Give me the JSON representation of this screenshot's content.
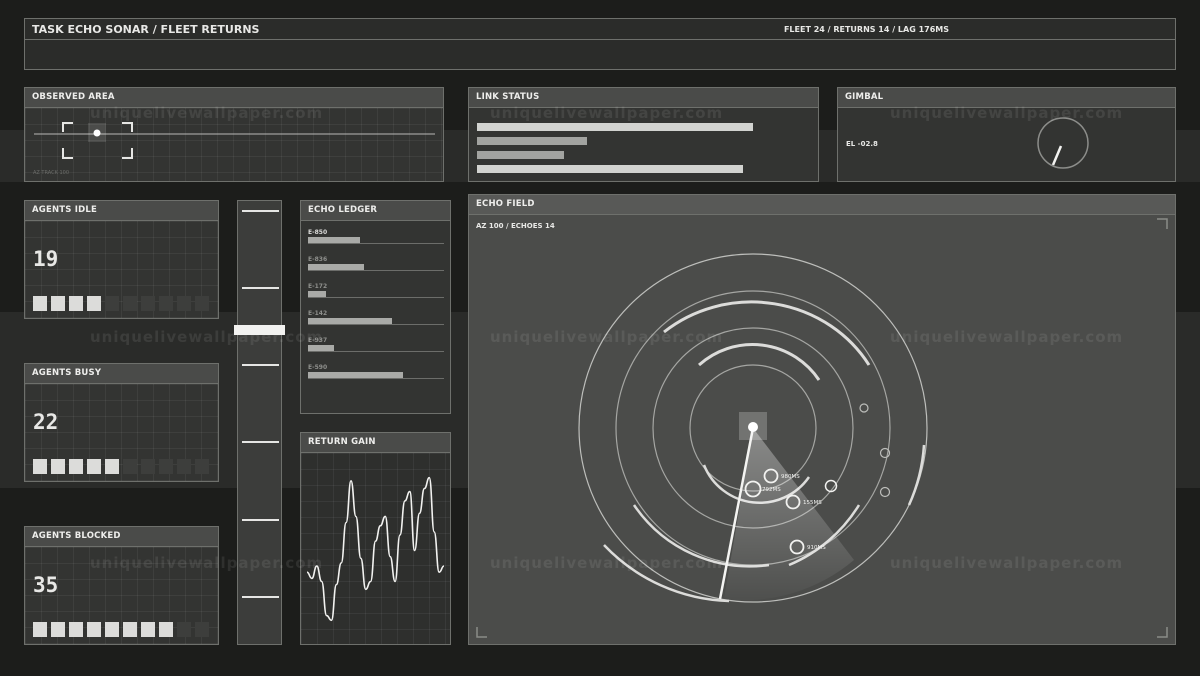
{
  "header": {
    "title": "TASK ECHO SONAR / FLEET RETURNS",
    "status": "FLEET 24 / RETURNS 14 / LAG 176MS"
  },
  "observed_area": {
    "title": "OBSERVED AREA",
    "caption": "AZ TRACK 100"
  },
  "link_status": {
    "title": "LINK STATUS",
    "bars": [
      0.83,
      0.33,
      0.26,
      0.8
    ]
  },
  "gimbal": {
    "title": "GIMBAL",
    "elevation": "EL -02.8"
  },
  "agents": [
    {
      "title": "AGENTS IDLE",
      "count": "19",
      "cells_on": 4,
      "cells_total": 10
    },
    {
      "title": "AGENTS BUSY",
      "count": "22",
      "cells_on": 5,
      "cells_total": 10
    },
    {
      "title": "AGENTS BLOCKED",
      "count": "35",
      "cells_on": 8,
      "cells_total": 10
    }
  ],
  "slider": {
    "value": 0.2
  },
  "echo_ledger": {
    "title": "ECHO LEDGER",
    "rows": [
      {
        "label": "E-850",
        "value": 0.38
      },
      {
        "label": "E-836",
        "value": 0.41
      },
      {
        "label": "E-172",
        "value": 0.13
      },
      {
        "label": "E-142",
        "value": 0.62
      },
      {
        "label": "E-937",
        "value": 0.19
      },
      {
        "label": "E-590",
        "value": 0.7
      }
    ]
  },
  "return_gain": {
    "title": "RETURN GAIN",
    "wave": [
      0.36,
      0.32,
      0.4,
      0.3,
      0.08,
      0.05,
      0.28,
      0.42,
      0.68,
      0.95,
      0.72,
      0.45,
      0.25,
      0.3,
      0.56,
      0.66,
      0.72,
      0.46,
      0.3,
      0.6,
      0.82,
      0.88,
      0.5,
      0.74,
      0.9,
      0.97,
      0.62,
      0.36,
      0.4
    ]
  },
  "echo_field": {
    "title": "ECHO FIELD",
    "readout": "AZ 100 / ECHOES 14",
    "echoes": [
      {
        "label": "980MS"
      },
      {
        "label": "792MS"
      },
      {
        "label": "155MS"
      },
      {
        "label": "910MS"
      }
    ]
  },
  "watermark": "uniquelivewallpaper.com",
  "colors": {
    "background": "#1c1d1b",
    "panel": "#333432",
    "header": "#4a4b49",
    "accent": "#e6e6e4"
  }
}
